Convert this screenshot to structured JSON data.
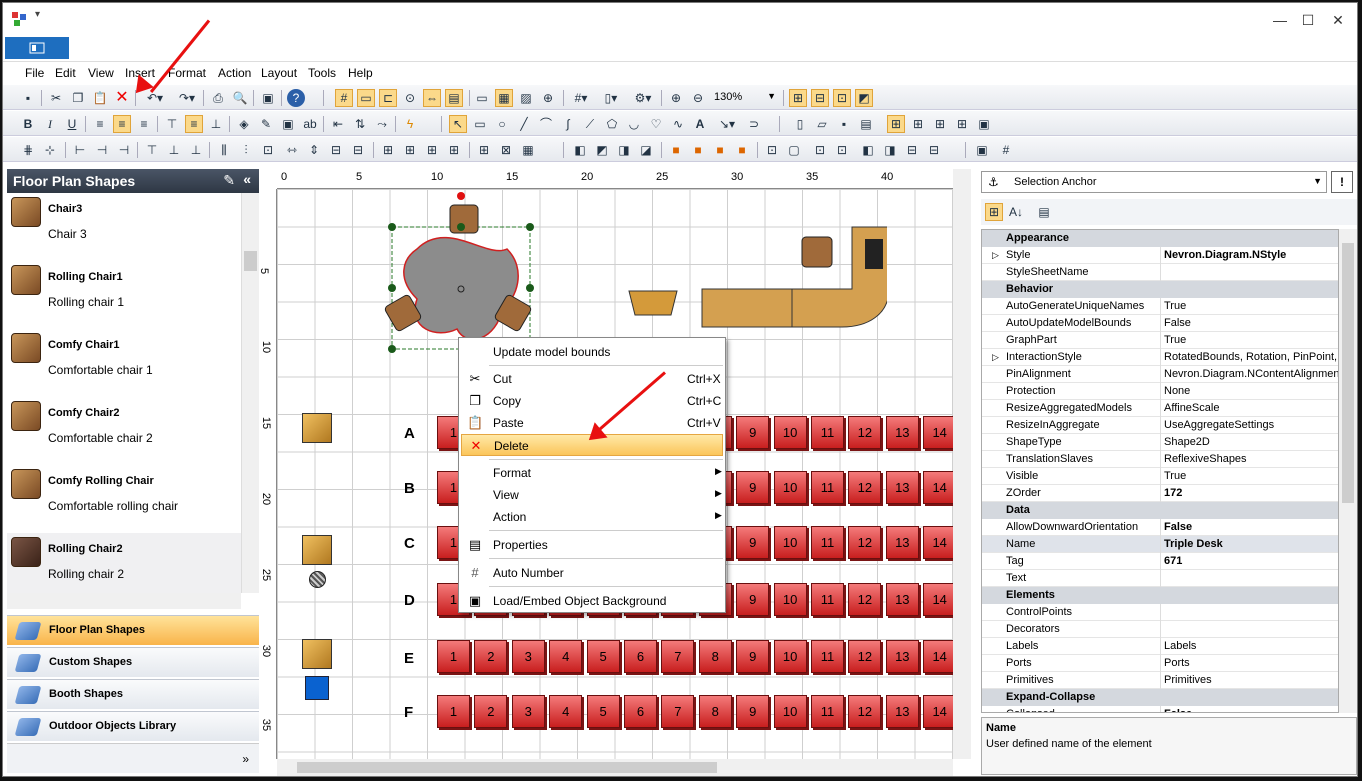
{
  "menu": [
    "File",
    "Edit",
    "View",
    "Insert",
    "Format",
    "Action",
    "Layout",
    "Tools",
    "Help"
  ],
  "toolbar": {
    "zoom": "130%"
  },
  "library": {
    "title": "Floor Plan Shapes",
    "items": [
      {
        "name": "Chair3",
        "desc": "Chair 3"
      },
      {
        "name": "Rolling Chair1",
        "desc": "Rolling chair 1"
      },
      {
        "name": "Comfy Chair1",
        "desc": "Comfortable chair 1"
      },
      {
        "name": "Comfy Chair2",
        "desc": "Comfortable chair 2"
      },
      {
        "name": "Comfy Rolling Chair",
        "desc": "Comfortable rolling chair"
      },
      {
        "name": "Rolling Chair2",
        "desc": "Rolling chair 2"
      }
    ],
    "libraries": [
      "Floor Plan Shapes",
      "Custom Shapes",
      "Booth Shapes",
      "Outdoor Objects Library"
    ]
  },
  "ruler": {
    "top": [
      "0",
      "5",
      "10",
      "15",
      "20",
      "25",
      "30",
      "35",
      "40"
    ],
    "left": [
      "5",
      "10",
      "15",
      "20",
      "25",
      "30",
      "35"
    ]
  },
  "rows": [
    "A",
    "B",
    "C",
    "D",
    "E",
    "F"
  ],
  "seat_numbers": [
    "1",
    "2",
    "3",
    "4",
    "5",
    "6",
    "7",
    "8",
    "9",
    "10",
    "11",
    "12",
    "13",
    "14"
  ],
  "context_menu": {
    "update": "Update model bounds",
    "cut": "Cut",
    "cut_sc": "Ctrl+X",
    "copy": "Copy",
    "copy_sc": "Ctrl+C",
    "paste": "Paste",
    "paste_sc": "Ctrl+V",
    "delete": "Delete",
    "format": "Format",
    "view": "View",
    "action": "Action",
    "properties": "Properties",
    "auto_number": "Auto Number",
    "load_bg": "Load/Embed Object Background"
  },
  "property_grid": {
    "selected": "Selection Anchor",
    "rows": [
      {
        "cat": "Appearance"
      },
      {
        "k": "Style",
        "v": "Nevron.Diagram.NStyle",
        "b": true,
        "exp": true
      },
      {
        "k": "StyleSheetName",
        "v": ""
      },
      {
        "cat": "Behavior"
      },
      {
        "k": "AutoGenerateUniqueNames",
        "v": "True"
      },
      {
        "k": "AutoUpdateModelBounds",
        "v": "False"
      },
      {
        "k": "GraphPart",
        "v": "True"
      },
      {
        "k": "InteractionStyle",
        "v": "RotatedBounds, Rotation, PinPoint, S",
        "exp": true
      },
      {
        "k": "PinAlignment",
        "v": "Nevron.Diagram.NContentAlignment"
      },
      {
        "k": "Protection",
        "v": "None"
      },
      {
        "k": "ResizeAggregatedModels",
        "v": "AffineScale"
      },
      {
        "k": "ResizeInAggregate",
        "v": "UseAggregateSettings"
      },
      {
        "k": "ShapeType",
        "v": "Shape2D"
      },
      {
        "k": "TranslationSlaves",
        "v": "ReflexiveShapes"
      },
      {
        "k": "Visible",
        "v": "True"
      },
      {
        "k": "ZOrder",
        "v": "172",
        "b": true
      },
      {
        "cat": "Data"
      },
      {
        "k": "AllowDownwardOrientation",
        "v": "False",
        "b": true
      },
      {
        "k": "Name",
        "v": "Triple Desk",
        "b": true
      },
      {
        "k": "Tag",
        "v": "671",
        "b": true
      },
      {
        "k": "Text",
        "v": ""
      },
      {
        "cat": "Elements"
      },
      {
        "k": "ControlPoints",
        "v": ""
      },
      {
        "k": "Decorators",
        "v": ""
      },
      {
        "k": "Labels",
        "v": "Labels"
      },
      {
        "k": "Ports",
        "v": "Ports"
      },
      {
        "k": "Primitives",
        "v": "Primitives"
      },
      {
        "cat": "Expand-Collapse"
      },
      {
        "k": "Collapsed",
        "v": "False",
        "b": true
      }
    ],
    "desc_title": "Name",
    "desc_text": "User defined name of the element"
  }
}
